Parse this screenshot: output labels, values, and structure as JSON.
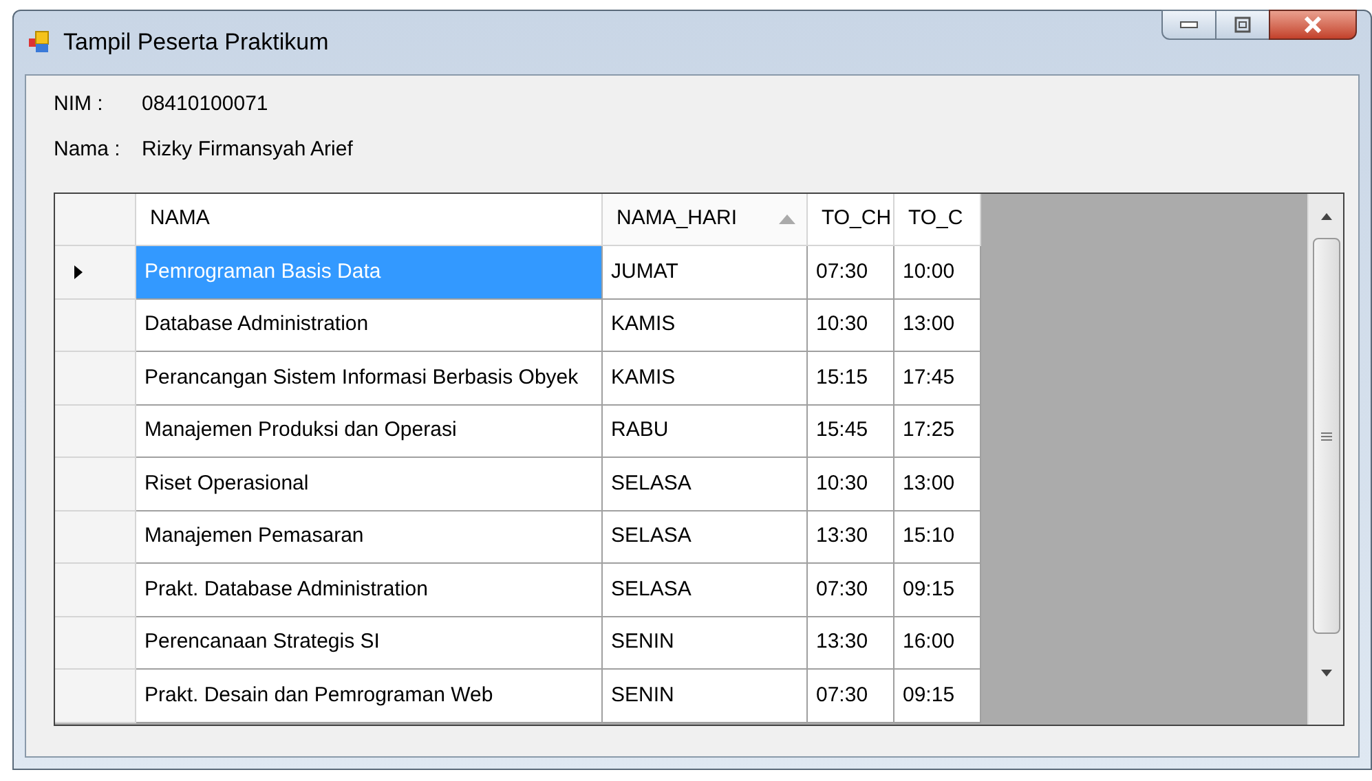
{
  "window": {
    "title": "Tampil Peserta Praktikum"
  },
  "fields": [
    {
      "label": "NIM :",
      "value": "08410100071"
    },
    {
      "label": "Nama :",
      "value": "Rizky Firmansyah Arief"
    }
  ],
  "table": {
    "columns": [
      {
        "label": "NAMA",
        "sorted": false
      },
      {
        "label": "NAMA_HARI",
        "sorted": true
      },
      {
        "label": "TO_CH",
        "sorted": false
      },
      {
        "label": "TO_C",
        "sorted": false
      }
    ],
    "rows": [
      {
        "selected": true,
        "cells": [
          "Pemrograman Basis Data",
          "JUMAT",
          "07:30",
          "10:00"
        ]
      },
      {
        "selected": false,
        "cells": [
          "Database Administration",
          "KAMIS",
          "10:30",
          "13:00"
        ]
      },
      {
        "selected": false,
        "cells": [
          "Perancangan Sistem Informasi Berbasis Obyek",
          "KAMIS",
          "15:15",
          "17:45"
        ]
      },
      {
        "selected": false,
        "cells": [
          "Manajemen Produksi dan Operasi",
          "RABU",
          "15:45",
          "17:25"
        ]
      },
      {
        "selected": false,
        "cells": [
          "Riset Operasional",
          "SELASA",
          "10:30",
          "13:00"
        ]
      },
      {
        "selected": false,
        "cells": [
          "Manajemen Pemasaran",
          "SELASA",
          "13:30",
          "15:10"
        ]
      },
      {
        "selected": false,
        "cells": [
          "Prakt. Database Administration",
          "SELASA",
          "07:30",
          "09:15"
        ]
      },
      {
        "selected": false,
        "cells": [
          "Perencanaan Strategis SI",
          "SENIN",
          "13:30",
          "16:00"
        ]
      },
      {
        "selected": false,
        "cells": [
          "Prakt. Desain dan Pemrograman Web",
          "SENIN",
          "07:30",
          "09:15"
        ]
      }
    ]
  }
}
